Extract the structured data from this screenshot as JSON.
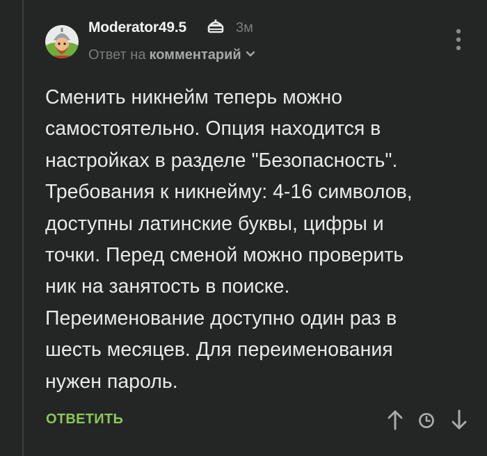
{
  "comment": {
    "author": "Moderator49.5",
    "author_badge": "moderator-hat-icon",
    "time_ago": "3м",
    "reply_to_prefix": "Ответ на",
    "reply_to_link": "комментарий",
    "body": "Сменить никнейм теперь можно\nсамостоятельно. Опция находится в\nнастройках в разделе \"Безопасность\".\nТребования к никнейму: 4-16 символов,\nдоступны латинские буквы, цифры и\nточки. Перед сменой можно проверить\nник на занятость в поиске.\nПереименование доступно один раз в\nшесть месяцев. Для переименования\nнужен пароль.",
    "actions": {
      "reply_label": "ОТВЕТИТЬ",
      "icons": [
        "arrow-up-icon",
        "clock-icon",
        "arrow-down-icon"
      ]
    }
  },
  "colors": {
    "background": "#242525",
    "text": "#e9e9e9",
    "muted": "#7b7c7d",
    "accent_green": "#8ac858"
  }
}
